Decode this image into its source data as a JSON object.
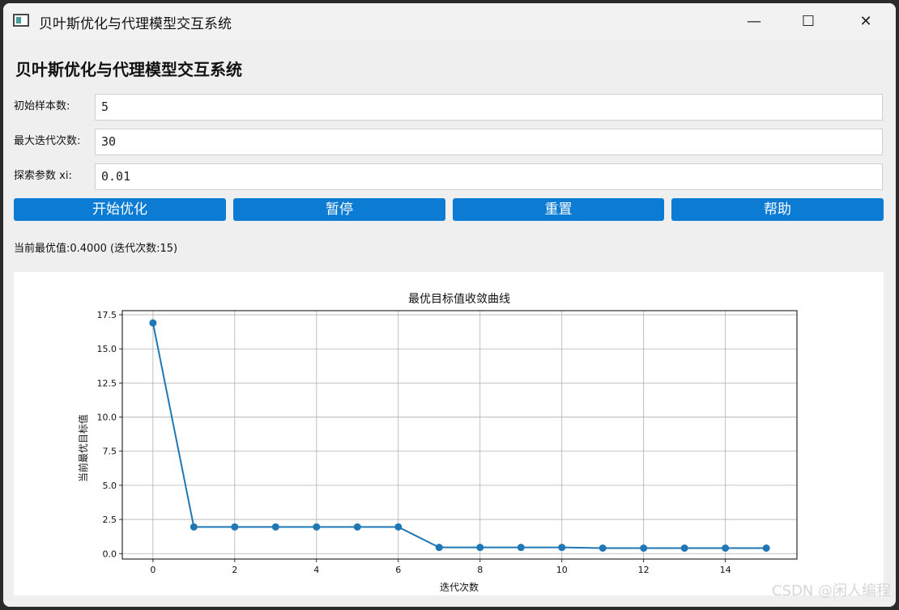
{
  "window": {
    "title": "贝叶斯优化与代理模型交互系统",
    "minimize": "—",
    "maximize": "☐",
    "close": "✕"
  },
  "app": {
    "heading": "贝叶斯优化与代理模型交互系统"
  },
  "fields": {
    "initial_samples": {
      "label": "初始样本数:",
      "value": "5"
    },
    "max_iterations": {
      "label": "最大迭代次数:",
      "value": "30"
    },
    "xi": {
      "label": "探索参数 xi:",
      "value": "0.01"
    }
  },
  "buttons": {
    "start": "开始优化",
    "pause": "暂停",
    "reset": "重置",
    "help": "帮助"
  },
  "status": "当前最优值:0.4000 (迭代次数:15)",
  "watermark": "CSDN @闲人编程",
  "colors": {
    "accent": "#0c7bd4",
    "line": "#1f77b4"
  },
  "chart_data": {
    "type": "line",
    "title": "最优目标值收敛曲线",
    "xlabel": "迭代次数",
    "ylabel": "当前最优目标值",
    "x": [
      0,
      1,
      2,
      3,
      4,
      5,
      6,
      7,
      8,
      9,
      10,
      11,
      12,
      13,
      14,
      15
    ],
    "values": [
      16.9,
      1.95,
      1.95,
      1.95,
      1.95,
      1.95,
      1.95,
      0.45,
      0.45,
      0.45,
      0.45,
      0.4,
      0.4,
      0.4,
      0.4,
      0.4
    ],
    "xticks": [
      "0",
      "2",
      "4",
      "6",
      "8",
      "10",
      "12",
      "14"
    ],
    "yticks": [
      "0.0",
      "2.5",
      "5.0",
      "7.5",
      "10.0",
      "12.5",
      "15.0",
      "17.5"
    ],
    "xlim": [
      -0.75,
      15.75
    ],
    "ylim": [
      -0.4,
      17.8
    ],
    "grid": true,
    "marker": "circle"
  }
}
